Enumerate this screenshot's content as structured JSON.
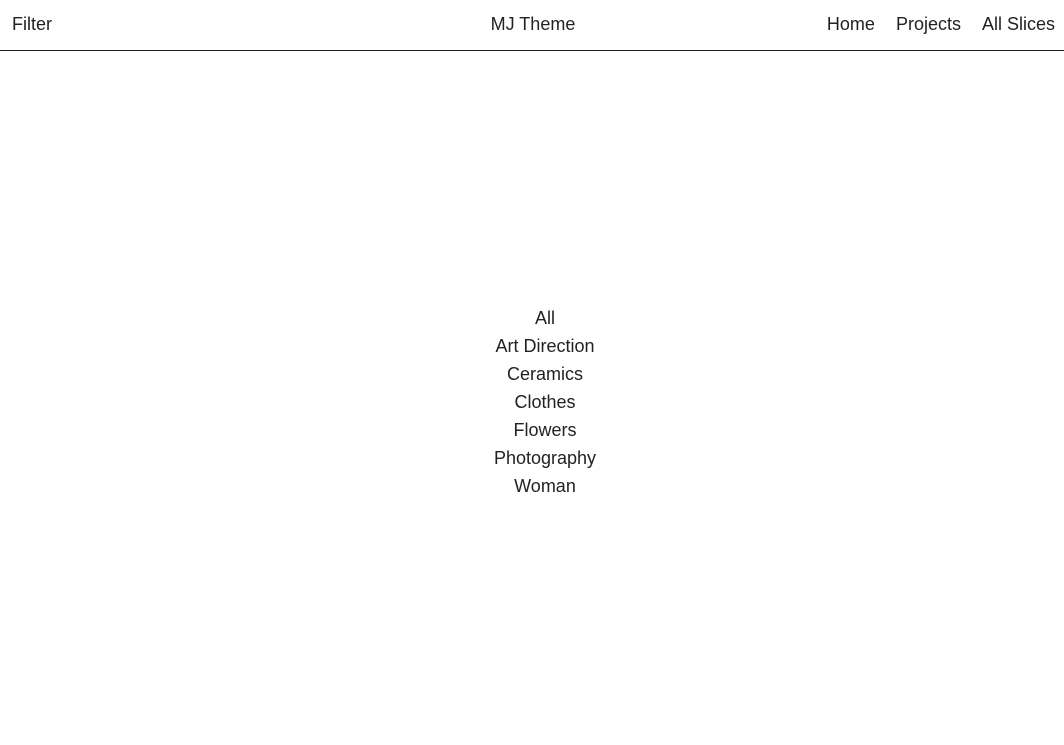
{
  "header": {
    "filter_label": "Filter",
    "site_title": "MJ Theme",
    "nav": [
      {
        "label": "Home"
      },
      {
        "label": "Projects"
      },
      {
        "label": "All Slices"
      }
    ]
  },
  "filters": [
    {
      "label": "All"
    },
    {
      "label": "Art Direction"
    },
    {
      "label": "Ceramics"
    },
    {
      "label": "Clothes"
    },
    {
      "label": "Flowers"
    },
    {
      "label": "Photography"
    },
    {
      "label": "Woman"
    }
  ],
  "colors": {
    "text": "#222222",
    "background": "#ffffff",
    "divider": "#222222"
  }
}
